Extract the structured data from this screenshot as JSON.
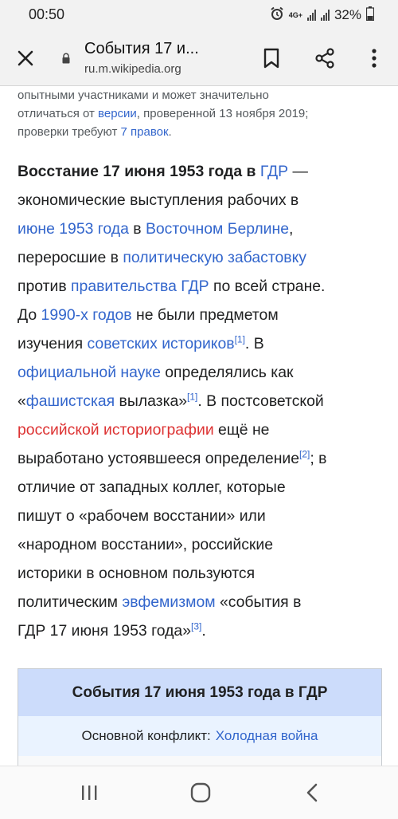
{
  "status_bar": {
    "time": "00:50",
    "network": "4G+",
    "battery": "32%"
  },
  "browser": {
    "page_title": "События 17 и...",
    "url_host": "ru.m.wikipedia.org"
  },
  "notice": {
    "line1": "опытными участниками и может значительно",
    "line2_pre": "отличаться от ",
    "line2_link": "версии",
    "line2_post": ", проверенной 13 ноября 2019;",
    "line3_pre": "проверки требуют ",
    "line3_link": "7 правок",
    "line3_post": "."
  },
  "lead": {
    "title_bold": "Восстание 17 июня 1953 года в ",
    "link_gdr": "ГДР",
    "dash": " —",
    "t1": "экономические выступления рабочих в",
    "link_june": "июне 1953 года",
    "t2": " в ",
    "link_east_berlin": "Восточном Берлине",
    "t3": ",",
    "t4": "переросшие в ",
    "link_strike": "политическую забастовку",
    "t5": "против ",
    "link_government": "правительства ГДР",
    "t6": " по всей стране.",
    "t7": "До ",
    "link_1990s": "1990-х годов",
    "t8": " не были предметом",
    "t9": "изучения ",
    "link_soviet_historians": "советских историков",
    "ref1": "[1]",
    "t10": ". В",
    "link_official_science": "официальной науке",
    "t11": " определялись как",
    "t12": "«",
    "link_fascist": "фашистская",
    "t13": " вылазка»",
    "ref1b": "[1]",
    "t14": ". В постсоветской",
    "link_russian_historiography": "российской историографии",
    "t15": " ещё не",
    "t16": "выработано устоявшееся определение",
    "ref2": "[2]",
    "t17": "; в",
    "t18": "отличие от западных коллег, которые",
    "t19": "пишут о «рабочем восстании» или",
    "t20": "«народном восстании», российские",
    "t21": "историки в основном пользуются",
    "t22": "политическим ",
    "link_euphemism": "эвфемизмом",
    "t23": " «события в",
    "t24": "ГДР 17 июня 1953 года»",
    "ref3": "[3]",
    "t25": "."
  },
  "infobox": {
    "title": "События 17 июня 1953 года в ГДР",
    "conflict_label": "Основной конфликт: ",
    "conflict_link": "Холодная война"
  },
  "colors": {
    "link": "#3366cc",
    "red_link": "#dd3333",
    "infobox_header": "#ccdcfb"
  },
  "icons": [
    "alarm-icon",
    "signal-icon",
    "battery-icon",
    "close-icon",
    "lock-icon",
    "bookmark-icon",
    "share-icon",
    "more-vertical-icon",
    "recent-apps-icon",
    "home-icon",
    "back-icon"
  ]
}
